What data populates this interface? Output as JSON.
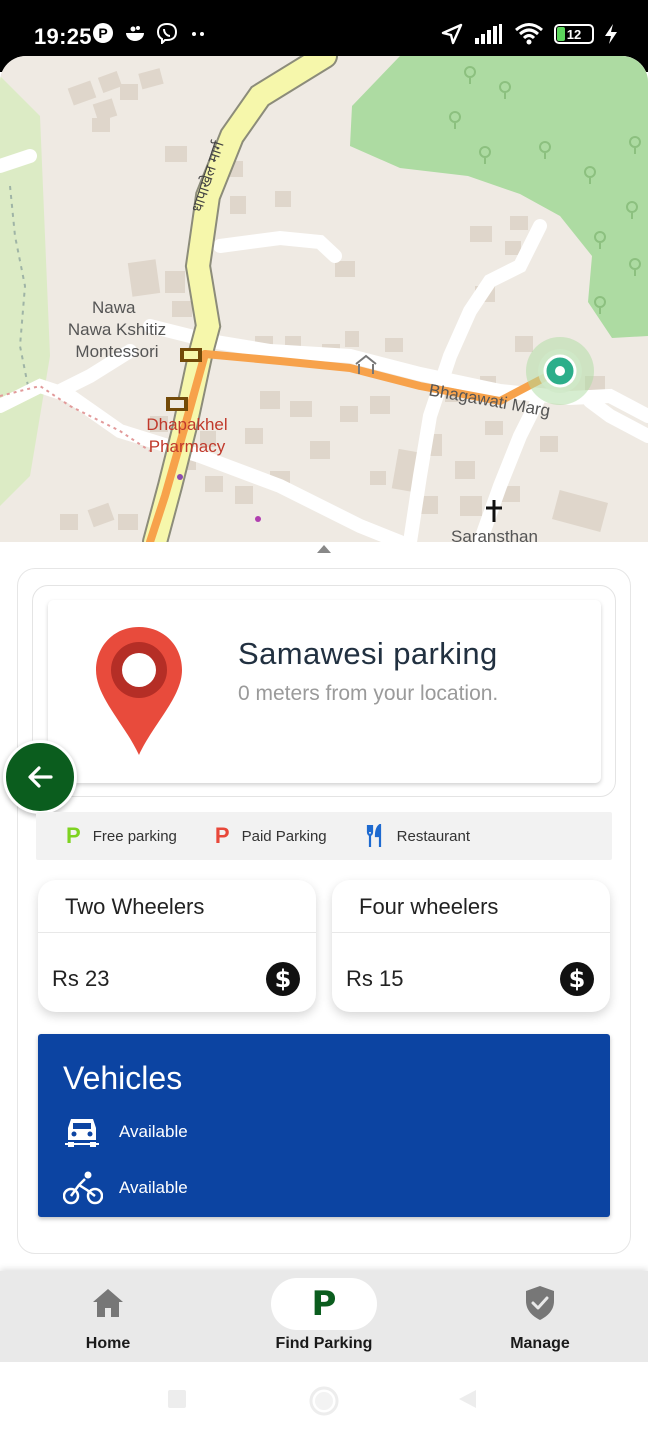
{
  "status_bar": {
    "time": "19:25",
    "battery": "12",
    "icons": [
      "p-badge-icon",
      "bowl-icon",
      "viber-icon",
      "more-dots-icon",
      "location-arrow-icon",
      "signal-icon",
      "wifi-icon",
      "battery-icon",
      "charging-icon"
    ]
  },
  "map": {
    "labels": {
      "road_nepali": "धापाखेल मार्ग",
      "school": "Nawa Kshitiz Montessori",
      "pharmacy": "Dhapakhel Pharmacy",
      "road": "Bhagawati Marg",
      "church": "Saransthan"
    },
    "route_color": "#f7a24b",
    "main_road_color": "#f6f7ab",
    "park_color": "#addba2",
    "destination_color": "#2cae8a"
  },
  "place": {
    "name": "Samawesi parking",
    "distance": "0 meters from your location.",
    "pin_color": "#e84b3c"
  },
  "legend": [
    {
      "glyph": "P",
      "label": "Free parking",
      "color": "#7ed321"
    },
    {
      "glyph": "P",
      "label": "Paid Parking",
      "color": "#e8483a"
    },
    {
      "glyph": "restaurant-icon",
      "label": "Restaurant",
      "color": "#1e6ad0"
    }
  ],
  "pricing": {
    "two_wheelers": {
      "title": "Two Wheelers",
      "price": "Rs 23"
    },
    "four_wheelers": {
      "title": "Four wheelers",
      "price": "Rs 15"
    }
  },
  "vehicles": {
    "title": "Vehicles",
    "car_status": "Available",
    "bike_status": "Available",
    "panel_color": "#0c44a2"
  },
  "nav": {
    "home": "Home",
    "find_parking": "Find Parking",
    "find_parking_glyph": "P",
    "manage": "Manage",
    "brand_color": "#0b5d1e"
  }
}
